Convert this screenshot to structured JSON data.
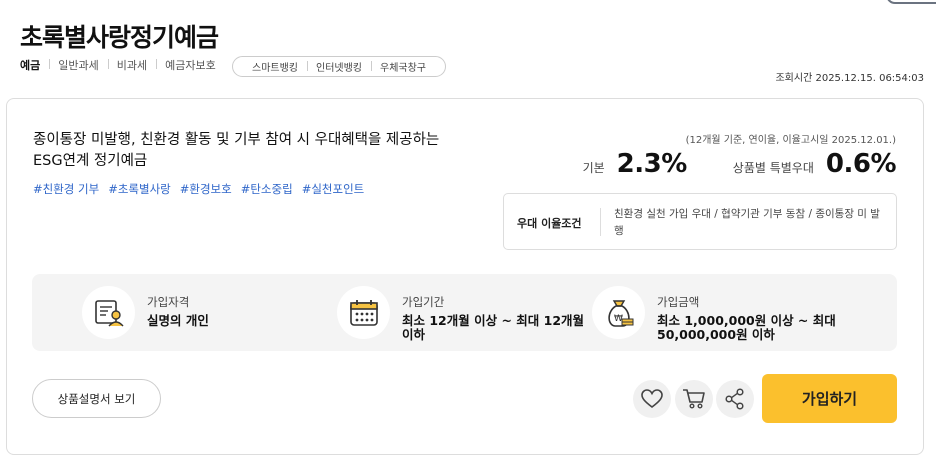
{
  "product": {
    "title": "초록별사랑정기예금",
    "tags": [
      "예금",
      "일반과세",
      "비과세",
      "예금자보호"
    ],
    "channels": [
      "스마트뱅킹",
      "인터넷뱅킹",
      "우체국창구"
    ],
    "lookup_time": "조회시간 2025.12.15. 06:54:03"
  },
  "summary": {
    "description": "종이통장 미발행, 친환경 활동 및 기부 참여 시 우대혜택을 제공하는 ESG연계 정기예금",
    "hashtags": [
      "#친환경 기부",
      "#초록별사랑",
      "#환경보호",
      "#탄소중립",
      "#실천포인트"
    ]
  },
  "rates": {
    "note": "(12개월 기준, 연이율, 이율고시일 2025.12.01.)",
    "base_label": "기본",
    "base_value": "2.3%",
    "bonus_label": "상품별 특별우대",
    "bonus_value": "0.6%"
  },
  "preference": {
    "label": "우대 이율조건",
    "conditions": "친환경 실천 가입 우대  /  협약기관 기부 동참  /  종이통장 미 발행"
  },
  "info": {
    "eligibility_label": "가입자격",
    "eligibility_value": "실명의 개인",
    "period_label": "가입기간",
    "period_value": "최소 12개월 이상 ~ 최대 12개월 이하",
    "amount_label": "가입금액",
    "amount_value": "최소 1,000,000원 이상 ~ 최대 50,000,000원 이하"
  },
  "actions": {
    "doc_button": "상품설명서 보기",
    "join_button": "가입하기"
  },
  "icons": {
    "eligibility": "id-document-icon",
    "period": "calendar-icon",
    "amount": "money-bag-icon",
    "favorite": "heart-icon",
    "cart": "cart-icon",
    "share": "share-icon"
  },
  "colors": {
    "accent": "#fbc02d",
    "hashtag": "#2f66c9"
  }
}
